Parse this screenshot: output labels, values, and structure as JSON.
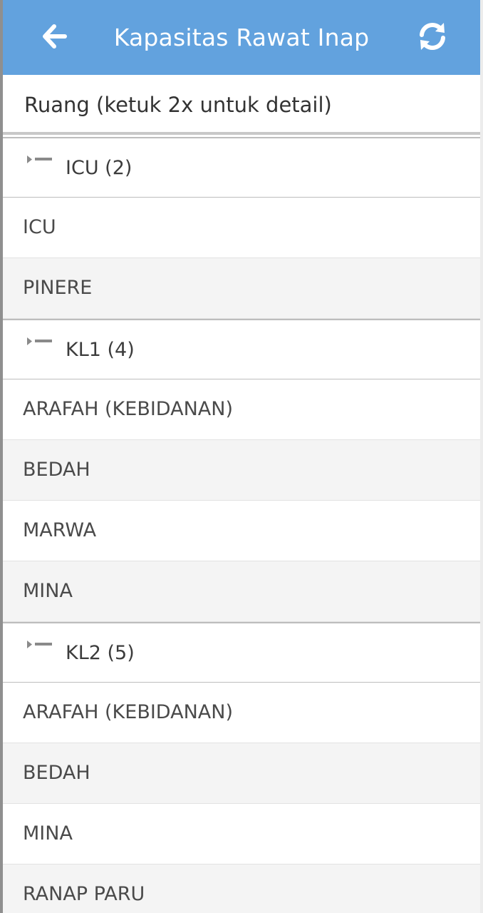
{
  "appbar": {
    "title": "Kapasitas Rawat Inap",
    "back_icon": "arrow-left-icon",
    "refresh_icon": "refresh-icon",
    "background_color": "#62a2de"
  },
  "list_header": {
    "label": "Ruang (ketuk 2x untuk detail)"
  },
  "groups": [
    {
      "label": "ICU (2)",
      "items": [
        "ICU",
        "PINERE"
      ]
    },
    {
      "label": "KL1 (4)",
      "items": [
        "ARAFAH (KEBIDANAN)",
        "BEDAH",
        "MARWA",
        "MINA"
      ]
    },
    {
      "label": "KL2 (5)",
      "items": [
        "ARAFAH (KEBIDANAN)",
        "BEDAH",
        "MINA",
        "RANAP PARU"
      ]
    }
  ]
}
